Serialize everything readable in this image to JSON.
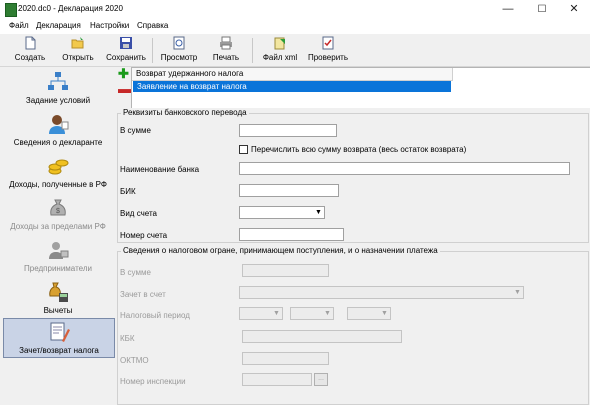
{
  "window": {
    "title": "2020.dc0 - Декларация 2020",
    "minimize": "—",
    "maximize": "☐",
    "close": "✕"
  },
  "menu": [
    "Файл",
    "Декларация",
    "Настройки",
    "Справка"
  ],
  "toolbar": {
    "create": "Создать",
    "open": "Открыть",
    "save": "Сохранить",
    "preview": "Просмотр",
    "print": "Печать",
    "xml": "Файл xml",
    "check": "Проверить"
  },
  "sidebar": [
    {
      "label": "Задание условий",
      "icon": "conditions-tree-icon",
      "state": "normal"
    },
    {
      "label": "Сведения о декларанте",
      "icon": "person-icon",
      "state": "normal"
    },
    {
      "label": "Доходы, полученные в РФ",
      "icon": "coins-icon",
      "state": "normal"
    },
    {
      "label": "Доходы за пределами РФ",
      "icon": "money-bag-icon",
      "state": "disabled"
    },
    {
      "label": "Предприниматели",
      "icon": "entrepreneur-icon",
      "state": "disabled"
    },
    {
      "label": "Вычеты",
      "icon": "deductions-icon",
      "state": "normal"
    },
    {
      "label": "Зачет/возврат налога",
      "icon": "refund-document-icon",
      "state": "active"
    }
  ],
  "list": {
    "header": "Возврат удержанного налога",
    "rows": [
      "Заявление на возврат налога"
    ]
  },
  "bank": {
    "title": "Реквизиты банковского перевода",
    "amount_label": "В сумме",
    "amount_value": "",
    "refund_all_label": "Перечислить всю сумму возврата (весь остаток возврата)",
    "refund_all_checked": false,
    "bank_name_label": "Наименование банка",
    "bank_name_value": "",
    "bik_label": "БИК",
    "bik_value": "",
    "account_type_label": "Вид счета",
    "account_type_value": "",
    "account_number_label": "Номер счета",
    "account_number_value": ""
  },
  "tax": {
    "title": "Сведения о налоговом огране, принимающем поступления, и о назначении платежа",
    "amount_label": "В сумме",
    "offset_label": "Зачет в счет",
    "period_label": "Налоговый период",
    "kbk_label": "КБК",
    "oktmo_label": "ОКТМО",
    "inspection_label": "Номер инспекции",
    "inspection_button": "..."
  },
  "colors": {
    "selection": "#0a74d9",
    "active_nav": "#c9d3e6",
    "add": "#1a9a1a",
    "remove": "#c62828"
  }
}
